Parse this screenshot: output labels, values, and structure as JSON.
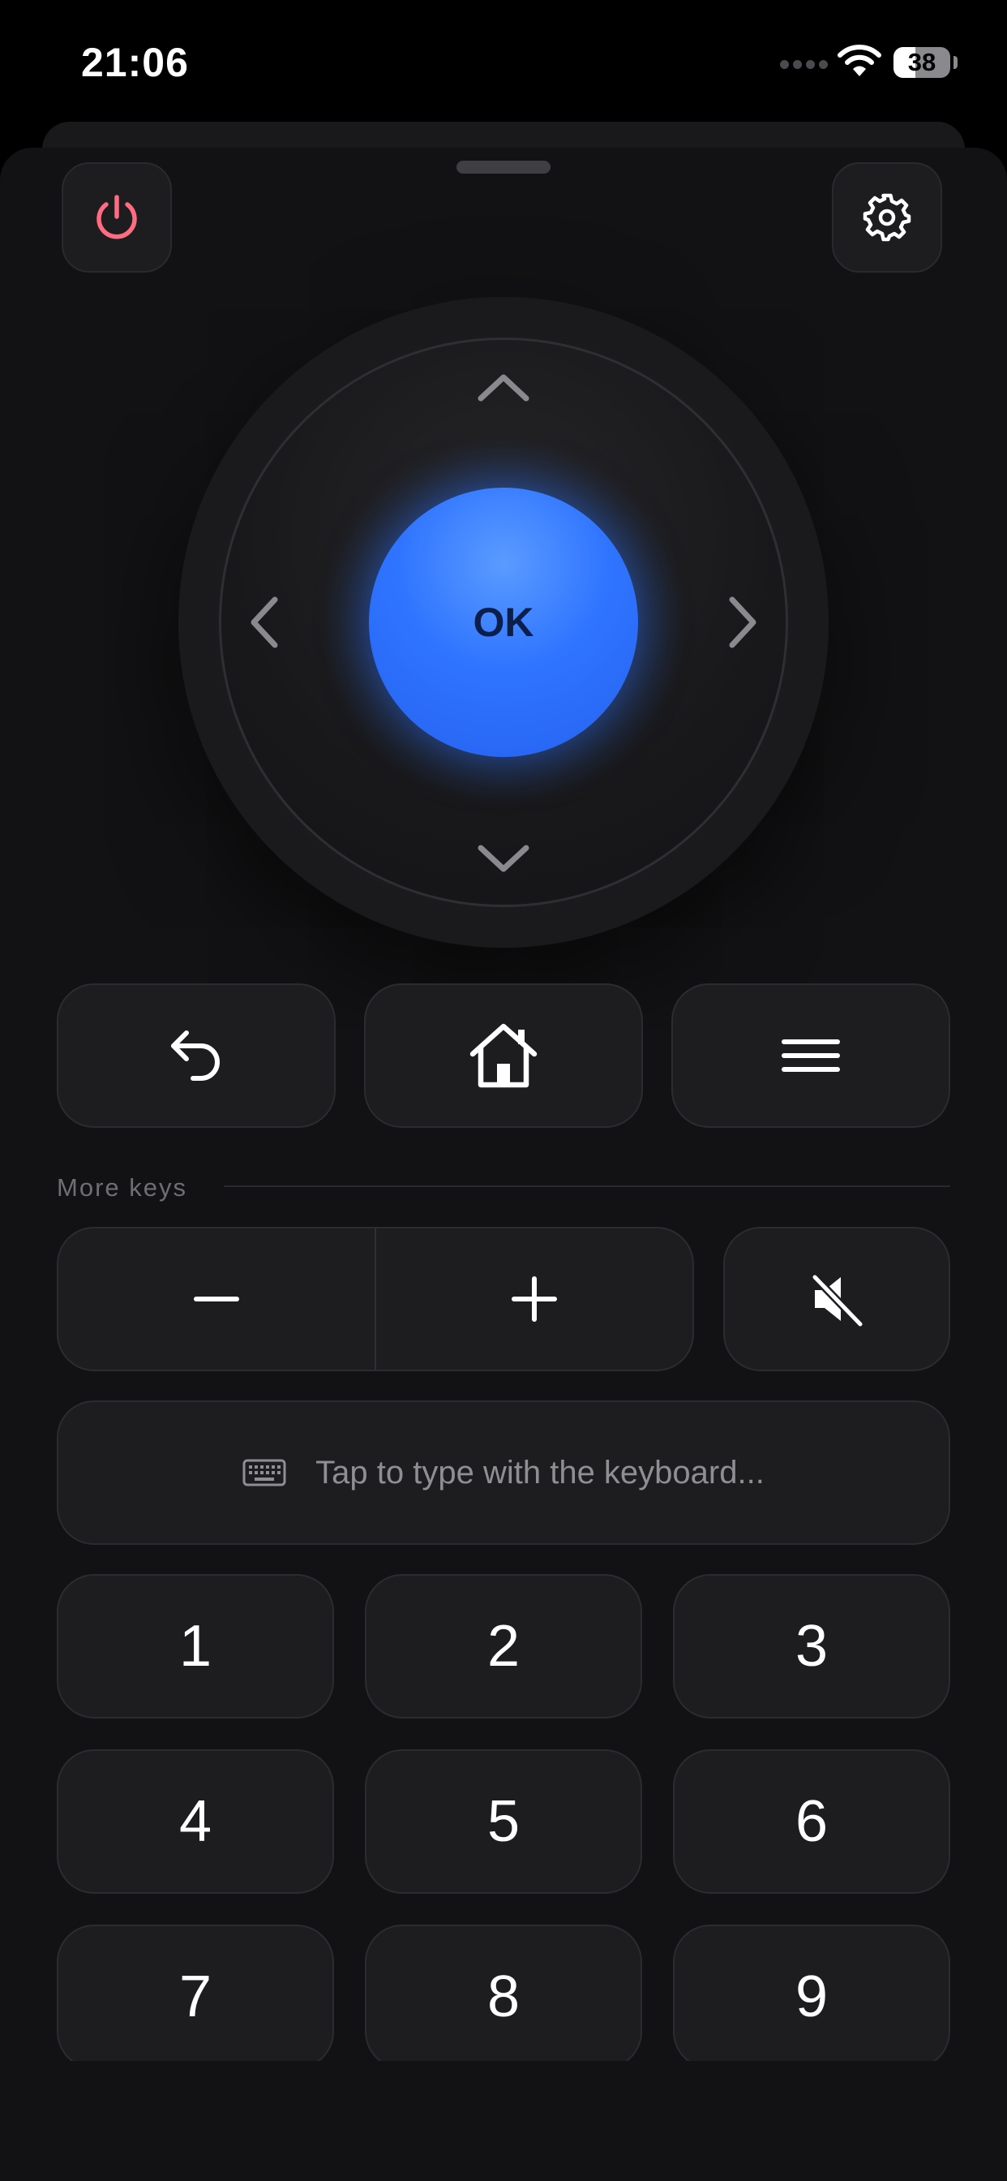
{
  "status_bar": {
    "time": "21:06",
    "battery_percent": "38",
    "battery_level": 0.38,
    "icons": [
      "cellular-dots-icon",
      "wifi-icon",
      "battery-icon"
    ]
  },
  "header": {
    "power_icon": "power-icon",
    "settings_icon": "gear-icon"
  },
  "dpad": {
    "ok_label": "OK",
    "arrows": [
      "chevron-up-icon",
      "chevron-left-icon",
      "chevron-right-icon",
      "chevron-down-icon"
    ]
  },
  "nav_buttons": [
    "back-arrow-icon",
    "home-icon",
    "menu-icon"
  ],
  "more_keys": {
    "label": "More keys",
    "volume_down_icon": "minus-icon",
    "volume_up_icon": "plus-icon",
    "mute_icon": "speaker-muted-icon"
  },
  "keyboard": {
    "icon": "keyboard-icon",
    "placeholder": "Tap to type with the keyboard..."
  },
  "number_pad": [
    "1",
    "2",
    "3",
    "4",
    "5",
    "6",
    "7",
    "8",
    "9"
  ],
  "colors": {
    "accent": "#2f74ff",
    "power": "#ff6b81",
    "background": "#121214",
    "button": "#1d1d20"
  }
}
